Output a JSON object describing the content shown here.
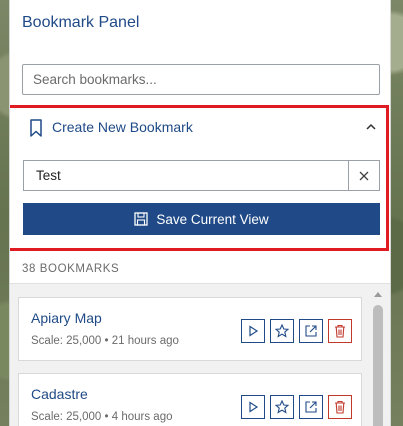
{
  "panel": {
    "title": "Bookmark Panel",
    "search_placeholder": "Search bookmarks..."
  },
  "create": {
    "title": "Create New Bookmark",
    "name_value": "Test",
    "save_label": "Save Current View"
  },
  "list": {
    "count_label": "38 BOOKMARKS",
    "items": [
      {
        "name": "Apiary Map",
        "meta": "Scale: 25,000 • 21 hours ago"
      },
      {
        "name": "Cadastre",
        "meta": "Scale: 25,000 • 4 hours ago"
      }
    ]
  },
  "colors": {
    "accent": "#1f4a87",
    "highlight_border": "#e01b22",
    "delete": "#c0392b"
  },
  "icons": [
    "bookmark-icon",
    "chevron-up-icon",
    "clear-icon",
    "save-icon",
    "play-icon",
    "star-icon",
    "share-icon",
    "trash-icon"
  ]
}
